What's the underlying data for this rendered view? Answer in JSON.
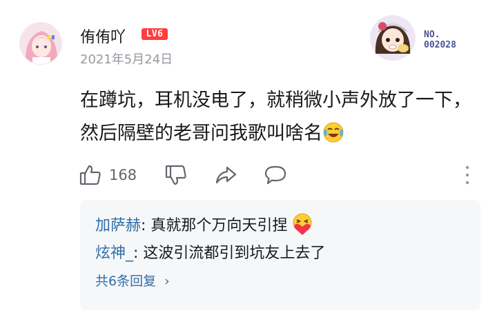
{
  "comment": {
    "username": "侑侑吖",
    "level_badge": "LV6",
    "date": "2021年5月24日",
    "text": "在蹲坑，耳机没电了，就稍微小声外放了一下，然后隔壁的老哥问我歌叫啥名",
    "text_emoji": "laugh-cry-emoji",
    "fan_badge": {
      "no_label": "NO.",
      "number": "002028"
    }
  },
  "actions": {
    "like_count": "168",
    "icons": [
      "thumbs-up-icon",
      "thumbs-down-icon",
      "share-icon",
      "reply-icon",
      "more-vertical-icon"
    ]
  },
  "replies": {
    "items": [
      {
        "name": "加萨赫",
        "separator": ":",
        "text": " 真就那个万向天引捏",
        "emoji": "hug-heart-emoji"
      },
      {
        "name": "炫神_",
        "separator": ":",
        "text": " 这波引流都引到坑友上去了"
      }
    ],
    "more_label": "共6条回复",
    "more_chevron": "›"
  },
  "colors": {
    "link_blue": "#2f6ea8",
    "level_red": "#ff3d3d",
    "muted_gray": "#9499a0",
    "reply_bg": "#f6f7f8"
  }
}
